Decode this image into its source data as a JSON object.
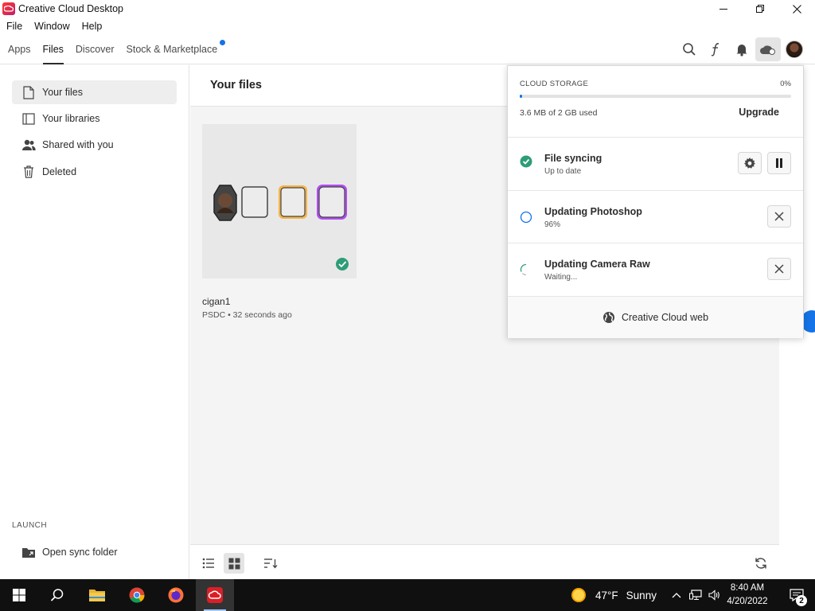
{
  "window": {
    "title": "Creative Cloud Desktop"
  },
  "menu": [
    "File",
    "Window",
    "Help"
  ],
  "tabs": [
    {
      "label": "Apps",
      "active": false
    },
    {
      "label": "Files",
      "active": true
    },
    {
      "label": "Discover",
      "active": false
    },
    {
      "label": "Stock & Marketplace",
      "active": false,
      "badge": true
    }
  ],
  "nav_icons": [
    "search-icon",
    "fonts-icon",
    "bell-icon",
    "cloud-icon",
    "avatar"
  ],
  "sidebar": {
    "items": [
      {
        "label": "Your files",
        "icon": "file-icon",
        "active": true
      },
      {
        "label": "Your libraries",
        "icon": "library-icon",
        "active": false
      },
      {
        "label": "Shared with you",
        "icon": "users-icon",
        "active": false
      },
      {
        "label": "Deleted",
        "icon": "trash-icon",
        "active": false
      }
    ],
    "launch_label": "LAUNCH",
    "launch_item": {
      "label": "Open sync folder",
      "icon": "folder-icon"
    }
  },
  "main": {
    "title": "Your files",
    "file": {
      "name": "cigan1",
      "meta": "PSDC • 32 seconds ago",
      "synced": true
    }
  },
  "cloud_popup": {
    "storage_label": "CLOUD STORAGE",
    "storage_percent": "0%",
    "storage_fraction": 0.002,
    "used_text": "3.6 MB of 2 GB used",
    "upgrade_label": "Upgrade",
    "rows": [
      {
        "title": "File syncing",
        "sub": "Up to date",
        "status": "done"
      },
      {
        "title": "Updating Photoshop",
        "sub": "96%",
        "status": "progress"
      },
      {
        "title": "Updating Camera Raw",
        "sub": "Waiting...",
        "status": "waiting"
      }
    ],
    "web_link": "Creative Cloud web"
  },
  "taskbar": {
    "weather_temp": "47°F",
    "weather_desc": "Sunny",
    "time": "8:40 AM",
    "date": "4/20/2022",
    "notification_count": "2"
  },
  "colors": {
    "accent": "#1473e6",
    "success": "#2d9d78",
    "taskbar": "#101010"
  }
}
